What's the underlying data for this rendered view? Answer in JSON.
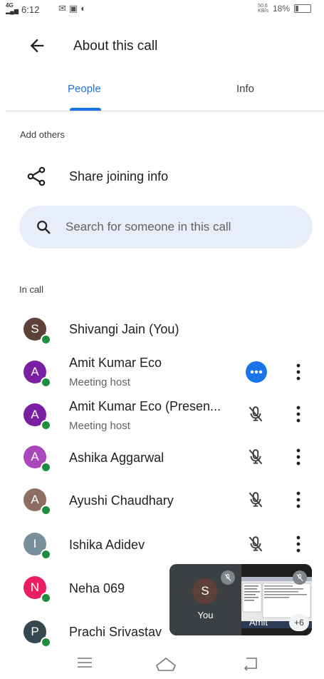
{
  "status_bar": {
    "time": "6:12",
    "network": "4G",
    "data_rate_top": "50.6",
    "data_rate_bottom": "KB/s",
    "battery": "18%"
  },
  "header": {
    "title": "About this call"
  },
  "tabs": [
    {
      "label": "People"
    },
    {
      "label": "Info"
    }
  ],
  "add_others": {
    "label": "Add others",
    "share_label": "Share joining info"
  },
  "search": {
    "placeholder": "Search for someone in this call"
  },
  "in_call": {
    "label": "In call"
  },
  "participants": [
    {
      "initial": "S",
      "name": "Shivangi Jain (You)",
      "subtitle": "",
      "color": "#5d4037"
    },
    {
      "initial": "A",
      "name": "Amit Kumar Eco",
      "subtitle": "Meeting host",
      "color": "#7b1fa2"
    },
    {
      "initial": "A",
      "name": "Amit Kumar Eco (Presen...",
      "subtitle": "Meeting host",
      "color": "#7b1fa2"
    },
    {
      "initial": "A",
      "name": "Ashika Aggarwal",
      "subtitle": "",
      "color": "#ab47bc"
    },
    {
      "initial": "A",
      "name": "Ayushi Chaudhary",
      "subtitle": "",
      "color": "#8d6e63"
    },
    {
      "initial": "I",
      "name": "Ishika Adidev",
      "subtitle": "",
      "color": "#78909c"
    },
    {
      "initial": "N",
      "name": "Neha 069",
      "subtitle": "",
      "color": "#e91e63"
    },
    {
      "initial": "P",
      "name": "Prachi Srivastav",
      "subtitle": "",
      "color": "#37474f"
    }
  ],
  "pip": {
    "you_initial": "S",
    "you_label": "You",
    "screen_label": "Amit",
    "more_count": "+6"
  },
  "colors": {
    "accent": "#1a73e8",
    "online": "#1e8e3e",
    "search_bg": "#e8eef9"
  }
}
